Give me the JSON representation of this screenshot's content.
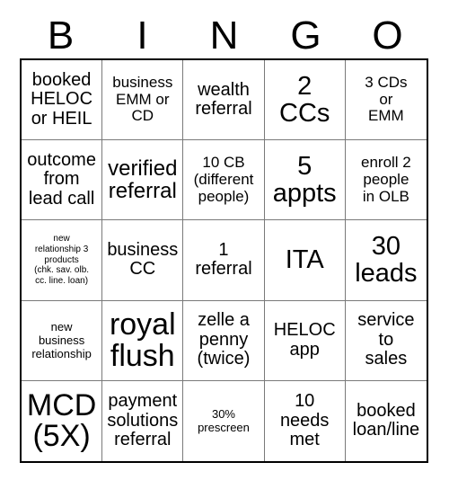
{
  "card": {
    "title": "BINGO",
    "header_letters": [
      "B",
      "I",
      "N",
      "G",
      "O"
    ],
    "grid_size": "5x5",
    "colors": {
      "background": "#ffffff",
      "text": "#000000",
      "outer_border": "#000000",
      "inner_border": "#7a7a7a"
    },
    "cells": [
      {
        "text": "booked\nHELOC\nor HEIL",
        "size": "md"
      },
      {
        "text": "business\nEMM or\nCD",
        "size": "sm"
      },
      {
        "text": "wealth\nreferral",
        "size": "md"
      },
      {
        "text": "2\nCCs",
        "size": "xl"
      },
      {
        "text": "3 CDs\nor\nEMM",
        "size": "sm"
      },
      {
        "text": "outcome\nfrom\nlead call",
        "size": "md"
      },
      {
        "text": "verified\nreferral",
        "size": "lg"
      },
      {
        "text": "10 CB\n(different\npeople)",
        "size": "sm"
      },
      {
        "text": "5\nappts",
        "size": "xl"
      },
      {
        "text": "enroll 2\npeople\nin OLB",
        "size": "sm"
      },
      {
        "text": "new\nrelationship 3\nproducts\n(chk. sav. olb.\ncc. line. loan)",
        "size": "xxs"
      },
      {
        "text": "business\nCC",
        "size": "md"
      },
      {
        "text": "1\nreferral",
        "size": "md"
      },
      {
        "text": "ITA",
        "size": "xl"
      },
      {
        "text": "30\nleads",
        "size": "xl"
      },
      {
        "text": "new\nbusiness\nrelationship",
        "size": "xs"
      },
      {
        "text": "royal\nflush",
        "size": "xxl"
      },
      {
        "text": "zelle a\npenny\n(twice)",
        "size": "md"
      },
      {
        "text": "HELOC\napp",
        "size": "md"
      },
      {
        "text": "service\nto\nsales",
        "size": "md"
      },
      {
        "text": "MCD\n(5X)",
        "size": "xxl"
      },
      {
        "text": "payment\nsolutions\nreferral",
        "size": "md"
      },
      {
        "text": "30%\nprescreen",
        "size": "xs"
      },
      {
        "text": "10\nneeds\nmet",
        "size": "md"
      },
      {
        "text": "booked\nloan/line",
        "size": "md"
      }
    ]
  }
}
